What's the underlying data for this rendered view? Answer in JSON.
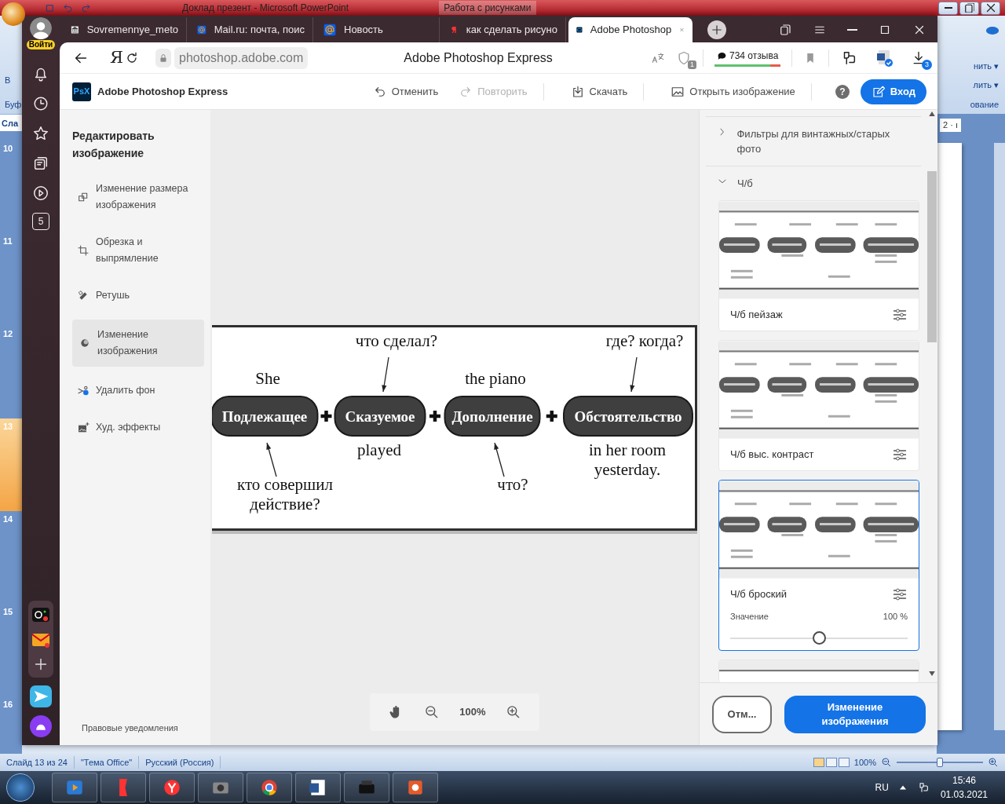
{
  "powerpoint": {
    "title": "Доклад презент - Microsoft PowerPoint",
    "context_tab": "Работа с рисунками",
    "ribbon_left": [
      "В",
      "Буф",
      "Сла"
    ],
    "ribbon_right": [
      "нить ▾",
      "лить ▾",
      "ование"
    ],
    "ruler_text": "2 · ı",
    "slides": [
      {
        "number": "10",
        "selected": false
      },
      {
        "number": "11",
        "selected": false
      },
      {
        "number": "12",
        "selected": false
      },
      {
        "number": "13",
        "selected": true
      },
      {
        "number": "14",
        "selected": false
      },
      {
        "number": "15",
        "selected": false
      },
      {
        "number": "16",
        "selected": false
      }
    ],
    "status_items": [
      "Слайд 13 из 24",
      "\"Тема Office\"",
      "Русский (Россия)"
    ],
    "zoom": "100%",
    "zoom_slider": {
      "level": 0.5
    }
  },
  "taskbar": {
    "apps": [
      {
        "kind": "media"
      },
      {
        "kind": "flag"
      },
      {
        "kind": "browser"
      },
      {
        "kind": "camera"
      },
      {
        "kind": "chrome"
      },
      {
        "kind": "word"
      },
      {
        "kind": "printer"
      },
      {
        "kind": "slides"
      }
    ],
    "language": "RU",
    "time": "15:46",
    "date": "01.03.2021"
  },
  "browser": {
    "profile_label": "Войти",
    "tabs": [
      {
        "title": "Sovremennye_meto",
        "kind": "building",
        "selected": false
      },
      {
        "title": "Mail.ru: почта, поис",
        "kind": "at",
        "selected": false
      },
      {
        "title": "Новость",
        "kind": "at",
        "selected": false
      },
      {
        "title": "как сделать рисуно",
        "kind": "flag",
        "selected": false
      },
      {
        "title": "Adobe Photoshop",
        "kind": "app",
        "selected": true
      }
    ],
    "home_letter": "Я",
    "address": "photoshop.adobe.com",
    "page_title": "Adobe Photoshop Express",
    "protect_count": "1",
    "reviews": "734 отзыва",
    "downloads_count": "3",
    "sidebar_counter": "5"
  },
  "app": {
    "logo": "PsX",
    "name": "Adobe Photoshop Express",
    "actions": [
      {
        "kind": "undo",
        "label": "Отменить",
        "disabled": false
      },
      {
        "kind": "redo",
        "label": "Повторить",
        "disabled": true
      },
      {
        "kind": "download",
        "label": "Скачать",
        "disabled": false
      },
      {
        "kind": "open",
        "label": "Открыть изображение",
        "disabled": false
      }
    ],
    "help": "?",
    "login": "Вход",
    "panel_title": "Редактировать изображение",
    "tools": [
      {
        "kind": "resize",
        "label": "Изменение размера изображения",
        "selected": false
      },
      {
        "kind": "crop",
        "label": "Обрезка и выпрямление",
        "selected": false
      },
      {
        "kind": "retouch",
        "label": "Ретушь",
        "selected": false
      },
      {
        "kind": "adjust",
        "label": "Изменение изображения",
        "selected": true
      },
      {
        "kind": "background",
        "label": "Удалить фон",
        "selected": false
      },
      {
        "kind": "effects",
        "label": "Худ. эффекты",
        "selected": false
      }
    ],
    "legal": "Правовые уведомления",
    "zoom": "100%",
    "diagram": {
      "parts": [
        {
          "name": "Подлежащее",
          "above": {
            "kind": "example",
            "lines": [
              "She"
            ]
          },
          "below": {
            "kind": "question",
            "lines": [
              "кто совершил",
              "действие?"
            ]
          }
        },
        {
          "name": "Сказуемое",
          "above": {
            "kind": "question",
            "lines": [
              "что сделал?"
            ]
          },
          "below": {
            "kind": "example",
            "lines": [
              "played"
            ]
          }
        },
        {
          "name": "Дополнение",
          "above": {
            "kind": "example",
            "lines": [
              "the piano"
            ]
          },
          "below": {
            "kind": "question",
            "lines": [
              "что?"
            ]
          }
        },
        {
          "name": "Обстоятельство",
          "above": {
            "kind": "question",
            "lines": [
              "где? когда?"
            ]
          },
          "below": {
            "kind": "example",
            "lines": [
              "in her room",
              "yesterday."
            ]
          }
        }
      ]
    },
    "filter_groups": [
      {
        "title": "Фильтры для винтажных/старых фото",
        "expanded": false
      },
      {
        "title": "Ч/б",
        "expanded": true
      }
    ],
    "filters": [
      {
        "name": "Ч/б пейзаж",
        "selected": false
      },
      {
        "name": "Ч/б выс. контраст",
        "selected": false
      },
      {
        "name": "Ч/б броский",
        "selected": true,
        "value_label": "Значение",
        "value": "100 %",
        "level": 0.5
      }
    ],
    "cancel": "Отм...",
    "apply": "Изменение изображения"
  }
}
